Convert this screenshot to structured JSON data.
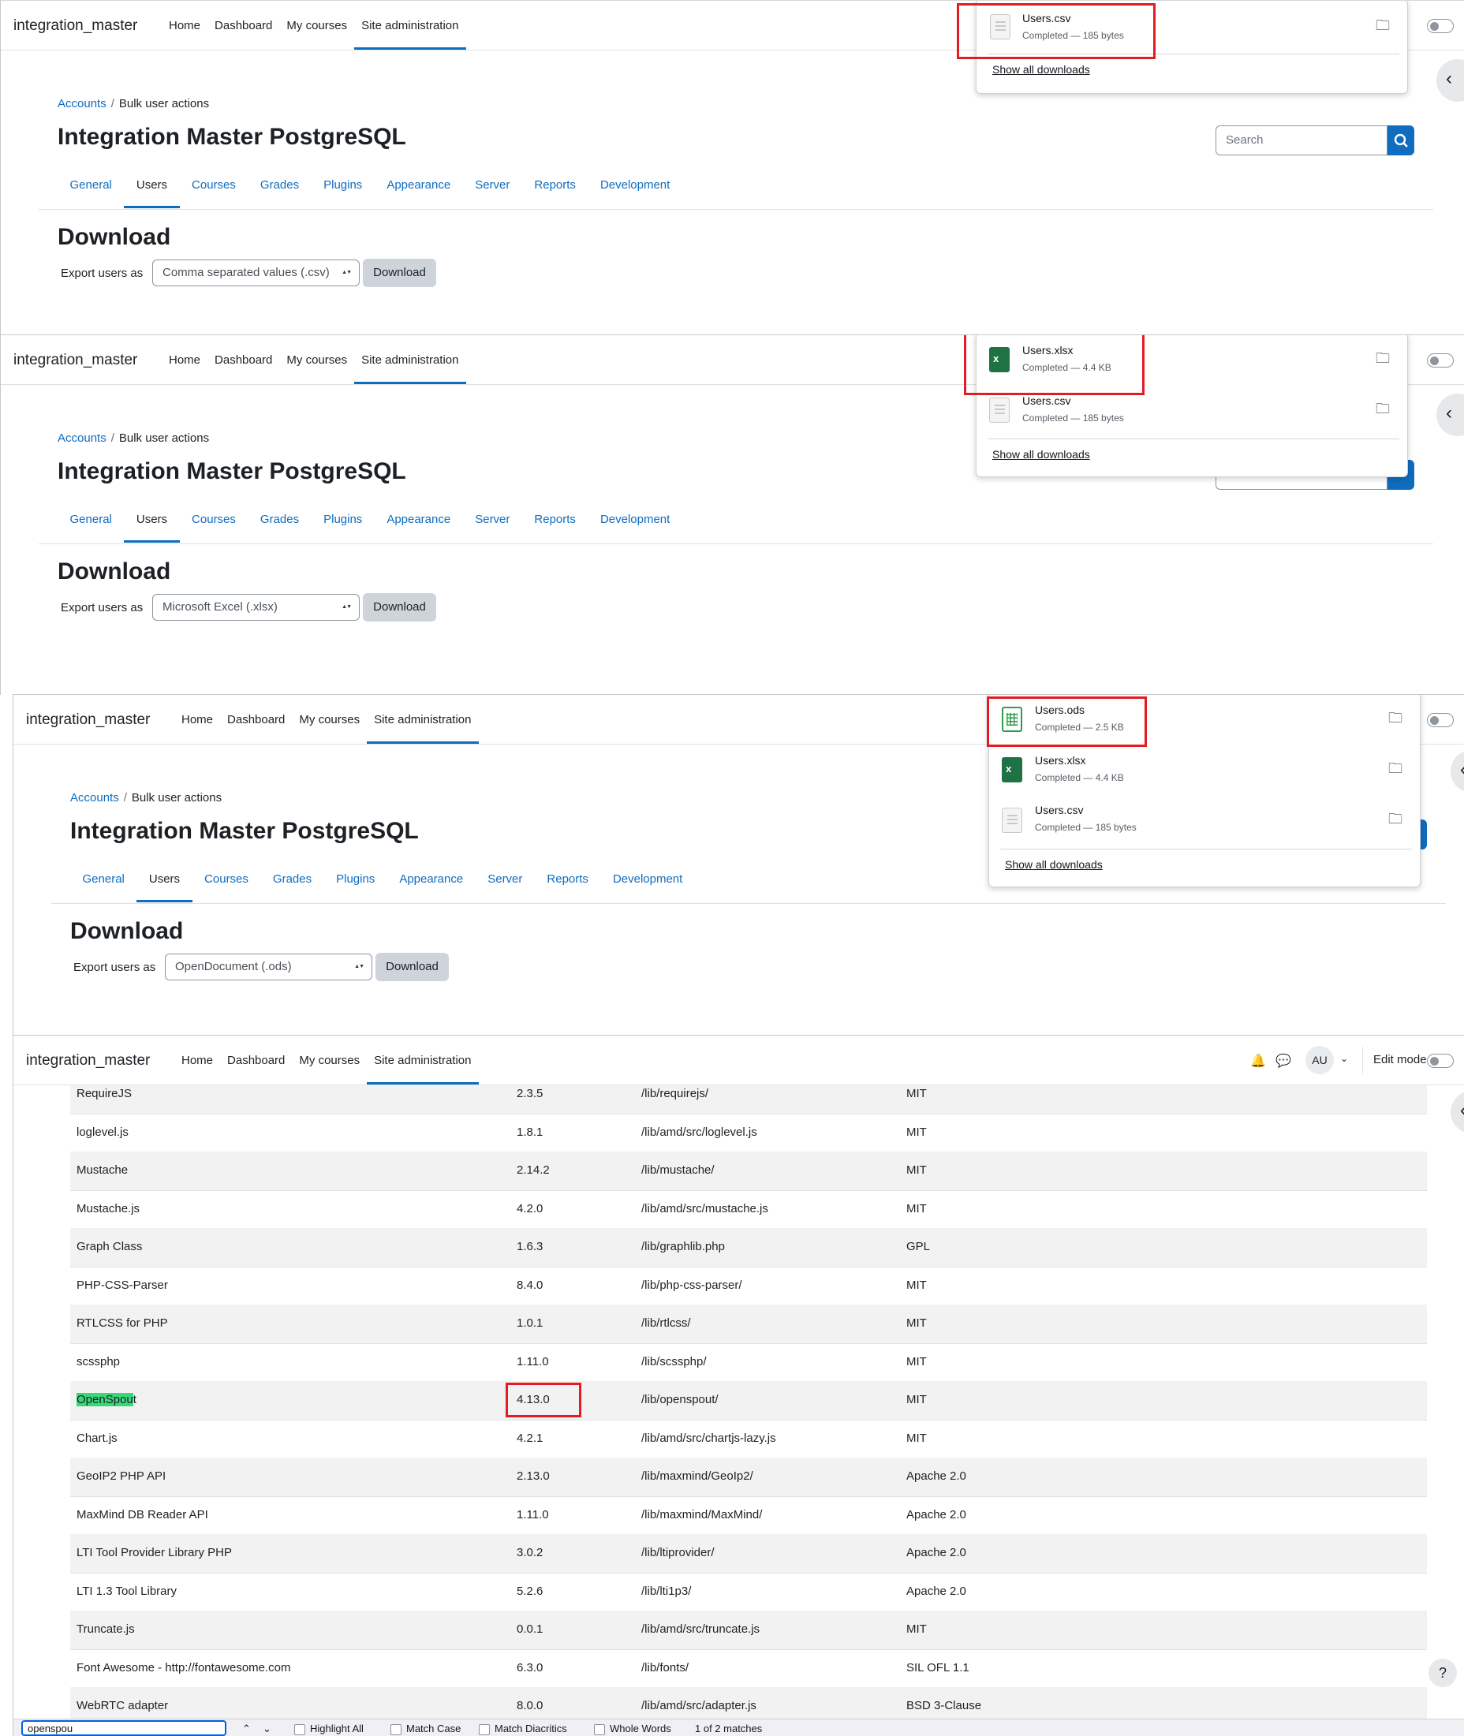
{
  "navbar": {
    "brand": "integration_master",
    "links": [
      "Home",
      "Dashboard",
      "My courses",
      "Site administration"
    ],
    "edit_mode_label": "Edit mode",
    "avatar_initials": "AU"
  },
  "breadcrumb": {
    "parent": "Accounts",
    "current": "Bulk user actions"
  },
  "page_title": "Integration Master PostgreSQL",
  "search_placeholder": "Search",
  "tabs": [
    "General",
    "Users",
    "Courses",
    "Grades",
    "Plugins",
    "Appearance",
    "Server",
    "Reports",
    "Development"
  ],
  "download_section": {
    "heading": "Download",
    "export_label": "Export users as",
    "button_label": "Download"
  },
  "screens": [
    {
      "selected_format": "Comma separated values (.csv)"
    },
    {
      "selected_format": "Microsoft Excel (.xlsx)"
    },
    {
      "selected_format": "OpenDocument (.ods)"
    }
  ],
  "downloads": {
    "csv": {
      "name": "Users.csv",
      "status": "Completed — 185 bytes"
    },
    "xlsx": {
      "name": "Users.xlsx",
      "status": "Completed — 4.4 KB"
    },
    "ods": {
      "name": "Users.ods",
      "status": "Completed — 2.5 KB"
    },
    "show_all_label": "Show all downloads"
  },
  "libraries": [
    [
      "RequireJS",
      "2.3.5",
      "/lib/requirejs/",
      "MIT"
    ],
    [
      "loglevel.js",
      "1.8.1",
      "/lib/amd/src/loglevel.js",
      "MIT"
    ],
    [
      "Mustache",
      "2.14.2",
      "/lib/mustache/",
      "MIT"
    ],
    [
      "Mustache.js",
      "4.2.0",
      "/lib/amd/src/mustache.js",
      "MIT"
    ],
    [
      "Graph Class",
      "1.6.3",
      "/lib/graphlib.php",
      "GPL"
    ],
    [
      "PHP-CSS-Parser",
      "8.4.0",
      "/lib/php-css-parser/",
      "MIT"
    ],
    [
      "RTLCSS for PHP",
      "1.0.1",
      "/lib/rtlcss/",
      "MIT"
    ],
    [
      "scssphp",
      "1.11.0",
      "/lib/scssphp/",
      "MIT"
    ],
    [
      "OpenSpout",
      "4.13.0",
      "/lib/openspout/",
      "MIT"
    ],
    [
      "Chart.js",
      "4.2.1",
      "/lib/amd/src/chartjs-lazy.js",
      "MIT"
    ],
    [
      "GeoIP2 PHP API",
      "2.13.0",
      "/lib/maxmind/GeoIp2/",
      "Apache 2.0"
    ],
    [
      "MaxMind DB Reader API",
      "1.11.0",
      "/lib/maxmind/MaxMind/",
      "Apache 2.0"
    ],
    [
      "LTI Tool Provider Library PHP",
      "3.0.2",
      "/lib/ltiprovider/",
      "Apache 2.0"
    ],
    [
      "LTI 1.3 Tool Library",
      "5.2.6",
      "/lib/lti1p3/",
      "Apache 2.0"
    ],
    [
      "Truncate.js",
      "0.0.1",
      "/lib/amd/src/truncate.js",
      "MIT"
    ],
    [
      "Font Awesome - http://fontawesome.com",
      "6.3.0",
      "/lib/fonts/",
      "SIL OFL 1.1"
    ],
    [
      "WebRTC adapter",
      "8.0.0",
      "/lib/amd/src/adapter.js",
      "BSD 3-Clause"
    ]
  ],
  "highlight": {
    "match_text": "OpenSpou",
    "rest_text": "t"
  },
  "findbar": {
    "query": "openspou",
    "highlight_all": "Highlight All",
    "match_case": "Match Case",
    "match_diacritics": "Match Diacritics",
    "whole_words": "Whole Words",
    "result": "1 of 2 matches"
  },
  "colors": {
    "accent": "#0f6cbf",
    "annotation": "#e31b23",
    "find_highlight": "#38d878"
  },
  "icons": [
    "search-icon",
    "folder-icon",
    "chevron-left-icon",
    "bell-icon",
    "chat-icon",
    "help-icon",
    "file-icon",
    "excel-icon",
    "spreadsheet-icon"
  ]
}
